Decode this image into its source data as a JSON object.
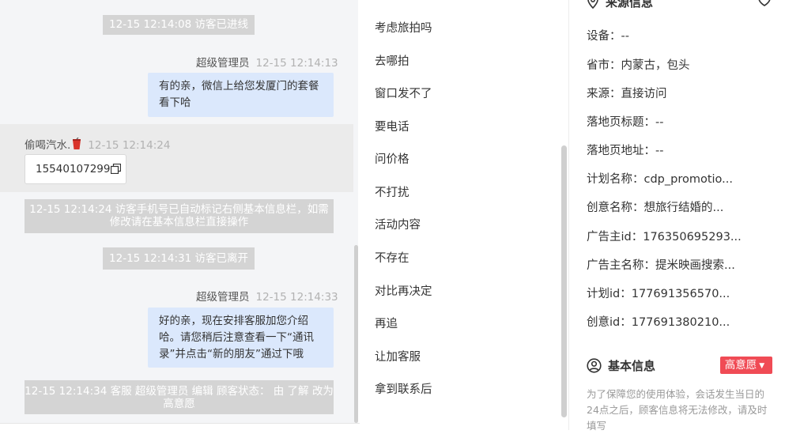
{
  "chat": {
    "system_messages": [
      {
        "text": "12-15 12:14:08 访客已进线"
      },
      {
        "text": "12-15 12:14:24 访客手机号已自动标记右侧基本信息栏，如需修改请在基本信息栏直接操作"
      },
      {
        "text": "12-15 12:14:31 访客已离开"
      },
      {
        "text": "12-15 12:14:34 客服 超级管理员 编辑 顾客状态： 由 了解 改为 高意愿"
      }
    ],
    "agent_messages": [
      {
        "sender": "超级管理员",
        "time": "12-15 12:14:13",
        "text": "有的亲，微信上给您发厦门的套餐看下哈"
      },
      {
        "sender": "超级管理员",
        "time": "12-15 12:14:33",
        "text": "好的亲，现在安排客服加您介绍哈。请您稍后注意查看一下“通讯录”并点击“新的朋友”通过下哦"
      }
    ],
    "visitor_message": {
      "sender": "偷喝汽水.",
      "time": "12-15 12:14:24",
      "text": "15540107299"
    }
  },
  "quick_replies": [
    "考虑旅拍吗",
    "去哪拍",
    "窗口发不了",
    "要电话",
    "问价格",
    "不打扰",
    "活动内容",
    "不存在",
    "对比再决定",
    "再追",
    "让加客服",
    "拿到联系后"
  ],
  "source_info": {
    "title": "来源信息",
    "rows": [
      "设备：--",
      "省市：内蒙古，包头",
      "来源：直接访问",
      "落地页标题：--",
      "落地页地址：--",
      "计划名称：cdp_promotio...",
      "创意名称：想旅行结婚的...",
      "广告主id：176350695293...",
      "广告主名称：提米映画搜索...",
      "计划id：177691356570...",
      "创意id：177691380210..."
    ]
  },
  "basic_info": {
    "title": "基本信息",
    "intent_label": "高意愿",
    "note": "为了保障您的使用体验，会话发生当日的24点之后，顾客信息将无法修改，请及时填写"
  },
  "colors": {
    "accent_badge": "#f04b55",
    "bubble_agent": "#dbe8fc",
    "system_msg": "#d4d4d4"
  }
}
